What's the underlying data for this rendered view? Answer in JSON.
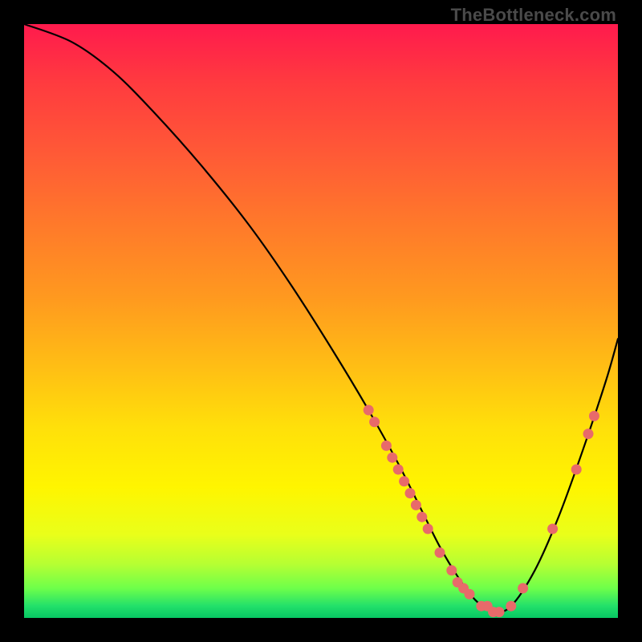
{
  "watermark": "TheBottleneck.com",
  "chart_data": {
    "type": "line",
    "title": "",
    "xlabel": "",
    "ylabel": "",
    "xlim": [
      0,
      100
    ],
    "ylim": [
      0,
      100
    ],
    "series": [
      {
        "name": "curve",
        "x": [
          0,
          8,
          15,
          22,
          30,
          38,
          45,
          52,
          58,
          63,
          67,
          70,
          73,
          76,
          79,
          82,
          86,
          90,
          94,
          98,
          100
        ],
        "y": [
          100,
          97,
          92,
          85,
          76,
          66,
          56,
          45,
          35,
          26,
          18,
          12,
          7,
          3,
          1,
          2,
          8,
          17,
          28,
          40,
          47
        ]
      }
    ],
    "markers": [
      {
        "x": 58,
        "y": 35
      },
      {
        "x": 59,
        "y": 33
      },
      {
        "x": 61,
        "y": 29
      },
      {
        "x": 62,
        "y": 27
      },
      {
        "x": 63,
        "y": 25
      },
      {
        "x": 64,
        "y": 23
      },
      {
        "x": 65,
        "y": 21
      },
      {
        "x": 66,
        "y": 19
      },
      {
        "x": 67,
        "y": 17
      },
      {
        "x": 68,
        "y": 15
      },
      {
        "x": 70,
        "y": 11
      },
      {
        "x": 72,
        "y": 8
      },
      {
        "x": 73,
        "y": 6
      },
      {
        "x": 74,
        "y": 5
      },
      {
        "x": 75,
        "y": 4
      },
      {
        "x": 77,
        "y": 2
      },
      {
        "x": 78,
        "y": 2
      },
      {
        "x": 79,
        "y": 1
      },
      {
        "x": 80,
        "y": 1
      },
      {
        "x": 82,
        "y": 2
      },
      {
        "x": 84,
        "y": 5
      },
      {
        "x": 89,
        "y": 15
      },
      {
        "x": 93,
        "y": 25
      },
      {
        "x": 95,
        "y": 31
      },
      {
        "x": 96,
        "y": 34
      }
    ],
    "colors": {
      "curve_stroke": "#000000",
      "marker_fill": "#e86a6a"
    }
  }
}
